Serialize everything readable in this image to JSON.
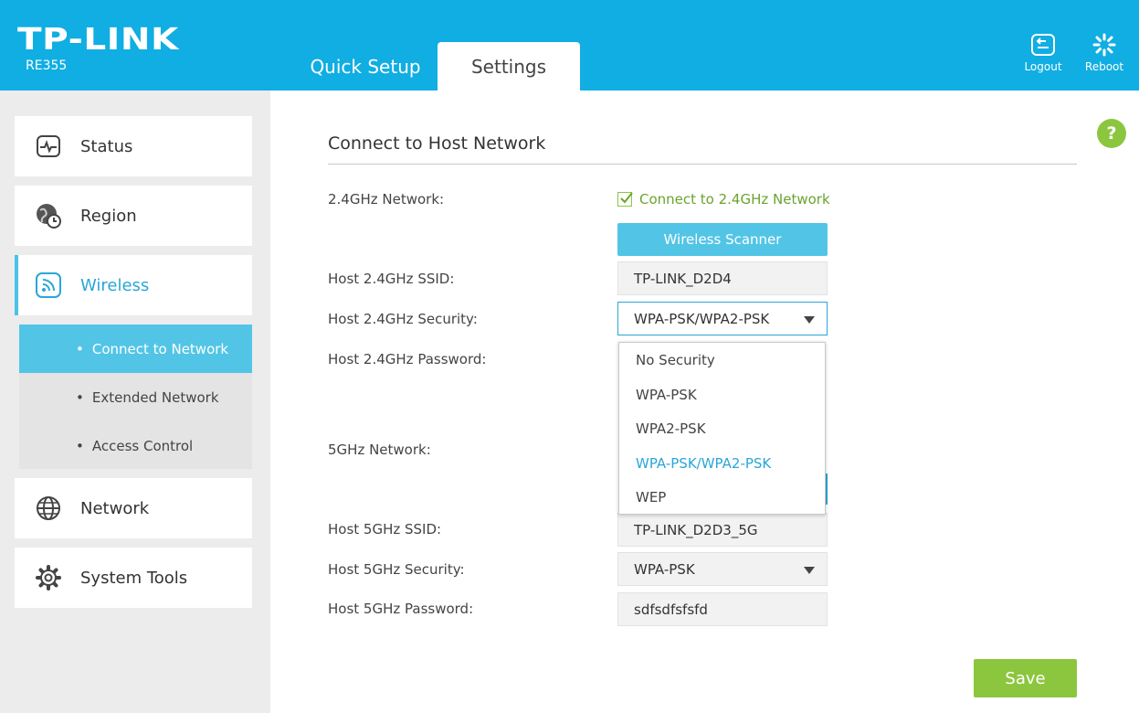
{
  "header": {
    "brand": "TP-LINK",
    "model": "RE355",
    "tabs": [
      {
        "label": "Quick Setup"
      },
      {
        "label": "Settings"
      }
    ],
    "logout_label": "Logout",
    "reboot_label": "Reboot"
  },
  "sidebar": {
    "items": [
      {
        "label": "Status",
        "icon": "status-pulse-icon"
      },
      {
        "label": "Region",
        "icon": "globe-clock-icon"
      },
      {
        "label": "Wireless",
        "icon": "wireless-signal-icon"
      },
      {
        "label": "Network",
        "icon": "globe-icon"
      },
      {
        "label": "System Tools",
        "icon": "gear-icon"
      }
    ],
    "subitems": [
      {
        "label": "Connect to Network"
      },
      {
        "label": "Extended Network"
      },
      {
        "label": "Access Control"
      }
    ]
  },
  "main": {
    "title": "Connect to Host Network",
    "labels": {
      "network24": "2.4GHz Network:",
      "ssid24": "Host 2.4GHz SSID:",
      "security24": "Host 2.4GHz Security:",
      "password24": "Host 2.4GHz Password:",
      "network5": "5GHz Network:",
      "ssid5": "Host 5GHz SSID:",
      "security5": "Host 5GHz Security:",
      "password5": "Host 5GHz Password:"
    },
    "connect24_label": "Connect to 2.4GHz Network",
    "connect24_checked": true,
    "scanner_label": "Wireless Scanner",
    "ssid24_value": "TP-LINK_D2D4",
    "security24_value": "WPA-PSK/WPA2-PSK",
    "security_options": [
      "No Security",
      "WPA-PSK",
      "WPA2-PSK",
      "WPA-PSK/WPA2-PSK",
      "WEP"
    ],
    "ssid5_value": "TP-LINK_D2D3_5G",
    "security5_value": "WPA-PSK",
    "password5_value": "sdfsdfsfsfd",
    "save_label": "Save",
    "help_label": "?"
  },
  "colors": {
    "header": "#10aee2",
    "accent": "#52c5e6",
    "active_text": "#2ba6d8",
    "green": "#8cc63f"
  }
}
